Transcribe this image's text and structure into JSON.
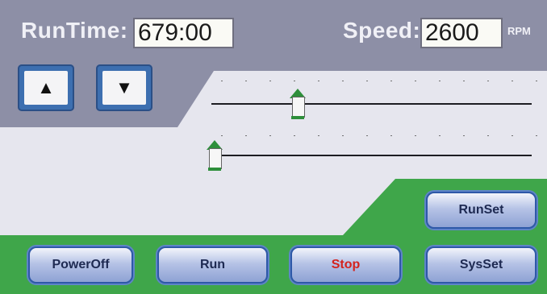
{
  "runtime": {
    "label": "RunTime:",
    "value": "679:00"
  },
  "speed": {
    "label": "Speed:",
    "value": "2600",
    "unit": "RPM"
  },
  "buttons": {
    "up_icon": "up-arrow-icon",
    "down_icon": "down-arrow-icon",
    "runset": "RunSet",
    "poweroff": "PowerOff",
    "run": "Run",
    "stop": "Stop",
    "sysset": "SysSet"
  },
  "colors": {
    "stop_text": "#d4231e",
    "accent_green": "#3fa64a",
    "panel": "#8d8fa6"
  },
  "sliders": [
    {
      "name": "upper",
      "fraction": 0.27
    },
    {
      "name": "lower",
      "fraction": 0.0
    }
  ]
}
